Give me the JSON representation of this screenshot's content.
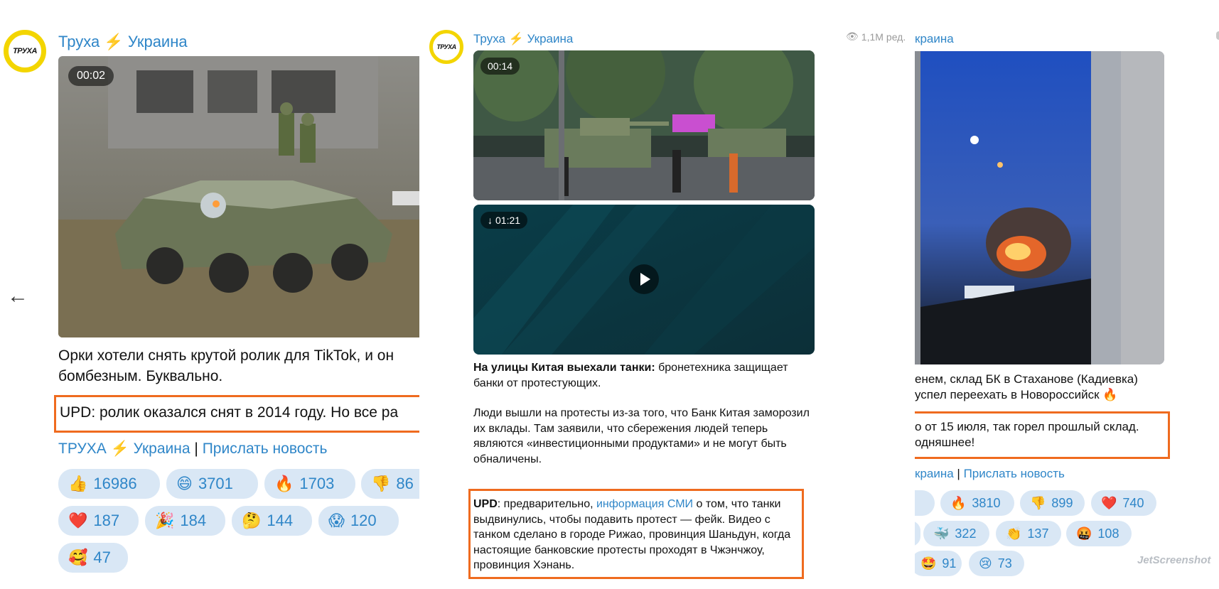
{
  "nav": {
    "back_arrow": "←"
  },
  "panel1": {
    "avatar_text": "ТРУХА",
    "channel": {
      "part1": "Труха",
      "bolt": "⚡",
      "part2": "Украина"
    },
    "video_duration": "00:02",
    "text": "Орки хотели снять крутой ролик для TikTok, и он получился бомбезным. Буквально.",
    "text_line1": "Орки хотели снять крутой ролик для TikTok, и он",
    "text_line2": "бомбезным. Буквально.",
    "upd": "UPD: ролик оказался снят в 2014 году. Но все ра",
    "footer": {
      "channel": "ТРУХА",
      "bolt": "⚡",
      "channel2": "Украина",
      "sep": "|",
      "link": "Прислать новость"
    },
    "reactions": [
      {
        "emoji": "👍",
        "count": "16986"
      },
      {
        "emoji": "😄",
        "count": "3701"
      },
      {
        "emoji": "🔥",
        "count": "1703"
      },
      {
        "emoji": "👎",
        "count": "86"
      },
      {
        "emoji": "❤️",
        "count": "187"
      },
      {
        "emoji": "🎉",
        "count": "184"
      },
      {
        "emoji": "🤔",
        "count": "144"
      },
      {
        "emoji": "😱",
        "count": "120"
      },
      {
        "emoji": "🥰",
        "count": "47"
      }
    ]
  },
  "panel2": {
    "avatar_text": "ТРУХА",
    "channel": {
      "part1": "Труха",
      "bolt": "⚡",
      "part2": "Украина"
    },
    "video1_duration": "00:14",
    "video2_duration": "01:21",
    "headline_bold": "На улицы Китая выехали танки:",
    "headline_rest": " бронетехника защищает банки от протестующих.",
    "paragraph": "Люди вышли на протесты из-за того, что Банк Китая заморозил их вклады. Там заявили, что сбережения людей теперь являются «инвестиционными продуктами» и не могут быть обналичены.",
    "upd_label": "UPD",
    "upd_pre": ": предварительно, ",
    "upd_link": "информация СМИ",
    "upd_post": " о том, что танки выдвинулись, чтобы подавить протест — фейк. Видео с танком сделано в городе Рижао, провинция Шаньдун, когда настоящие банковские протесты проходят в Чжэнчжоу, провинция Хэнань."
  },
  "panel3": {
    "views": "1,1M",
    "edited": "ред.",
    "channel_partial": "краина",
    "text_line1": "енем, склад БК в Стаханове (Кадиевка)",
    "text_line2": "успел переехать в Новороссийск 🔥",
    "upd_line1": "о от 15 июля, так горел прошлый склад.",
    "upd_line2": "одняшнее!",
    "footer": {
      "channel": "краина",
      "sep": "|",
      "link": "Прислать новость"
    },
    "reactions": [
      {
        "emoji": "",
        "count": ""
      },
      {
        "emoji": "🔥",
        "count": "3810"
      },
      {
        "emoji": "👎",
        "count": "899"
      },
      {
        "emoji": "❤️",
        "count": "740"
      },
      {
        "emoji": "",
        "count": ""
      },
      {
        "emoji": "🐳",
        "count": "322"
      },
      {
        "emoji": "👏",
        "count": "137"
      },
      {
        "emoji": "🤬",
        "count": "108"
      },
      {
        "emoji": "🤩",
        "count": "91"
      },
      {
        "emoji": "😢",
        "count": "73"
      }
    ]
  },
  "watermark": "JetScreenshot",
  "colors": {
    "link": "#2f86c8",
    "chip_bg": "#d9e7f5",
    "highlight": "#ef6b1f",
    "avatar_ring": "#f3d500"
  }
}
